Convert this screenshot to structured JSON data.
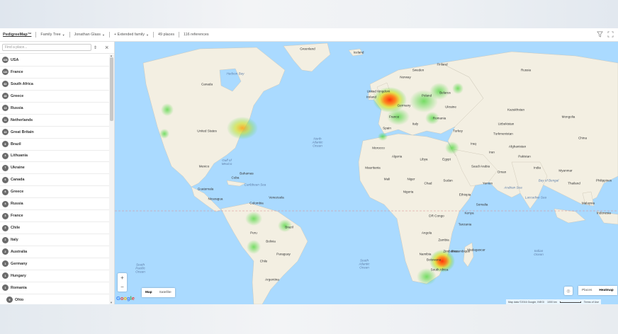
{
  "toolbar": {
    "brand": "PedigreeMap™",
    "family_tree": "Family Tree",
    "person": "Jonathan Glass",
    "extended": "+ Extended family",
    "places": "49 places",
    "references": "116 references"
  },
  "sidebar": {
    "search_placeholder": "Find a place...",
    "places": [
      {
        "count": "328",
        "name": "USA"
      },
      {
        "count": "110",
        "name": "France"
      },
      {
        "count": "62",
        "name": "South Africa"
      },
      {
        "count": "46",
        "name": "Greece"
      },
      {
        "count": "13",
        "name": "Russia"
      },
      {
        "count": "11",
        "name": "Netherlands"
      },
      {
        "count": "10",
        "name": "Great Britain"
      },
      {
        "count": "6",
        "name": "Brazil"
      },
      {
        "count": "4",
        "name": "Lithuania"
      },
      {
        "count": "7",
        "name": "Ukraine"
      },
      {
        "count": "6",
        "name": "Canada"
      },
      {
        "count": "6",
        "name": "Greece"
      },
      {
        "count": "4",
        "name": "Russia"
      },
      {
        "count": "3",
        "name": "France"
      },
      {
        "count": "2",
        "name": "Chile"
      },
      {
        "count": "2",
        "name": "Italy"
      },
      {
        "count": "2",
        "name": "Australia"
      },
      {
        "count": "1",
        "name": "Germany"
      },
      {
        "count": "1",
        "name": "Hungary"
      },
      {
        "count": "1",
        "name": "Romania"
      },
      {
        "count": "9",
        "name": "Ohio"
      }
    ]
  },
  "map": {
    "labels": {
      "greenland": "Greenland",
      "iceland": "Iceland",
      "hudson_bay": "Hudson Bay",
      "canada": "Canada",
      "united_states": "United States",
      "mexico": "Mexico",
      "gulf_mexico": "Gulf of\nMexico",
      "cuba": "Cuba",
      "caribbean": "Caribbean Sea",
      "venezuela": "Venezuela",
      "colombia": "Colombia",
      "peru": "Peru",
      "brazil": "Brazil",
      "bolivia": "Bolivia",
      "paraguay": "Paraguay",
      "chile": "Chile",
      "argentina": "Argentina",
      "north_atlantic": "North\nAtlantic\nOcean",
      "south_atlantic": "South\nAtlantic\nOcean",
      "south_pacific": "South\nPacific\nOcean",
      "indian_ocean": "Indian\nOcean",
      "sweden": "Sweden",
      "finland": "Finland",
      "norway": "Norway",
      "united_kingdom": "United\nKingdom",
      "ireland": "Ireland",
      "germany": "Germany",
      "poland": "Poland",
      "belarus": "Belarus",
      "ukraine": "Ukraine",
      "france": "France",
      "spain": "Spain",
      "italy": "Italy",
      "romania": "Romania",
      "turkey": "Turkey",
      "russia": "Russia",
      "kazakhstan": "Kazakhstan",
      "mongolia": "Mongolia",
      "china": "China",
      "turkmenistan": "Turkmenistan",
      "afghanistan": "Afghanistan",
      "iran": "Iran",
      "iraq": "Iraq",
      "pakistan": "Pakistan",
      "india": "India",
      "saudi_arabia": "Saudi Arabia",
      "egypt": "Egypt",
      "libya": "Libya",
      "algeria": "Algeria",
      "morocco": "Morocco",
      "mali": "Mali",
      "niger": "Niger",
      "chad": "Chad",
      "sudan": "Sudan",
      "ethiopia": "Ethiopia",
      "nigeria": "Nigeria",
      "kenya": "Kenya",
      "tanzania": "Tanzania",
      "dr_congo": "DR Congo",
      "angola": "Angola",
      "namibia": "Namibia",
      "south_africa": "South Africa",
      "madagascar": "Madagascar",
      "mauritania": "Mauritania",
      "myanmar": "Myanmar",
      "thailand": "Thailand",
      "philippines": "Philippines",
      "indonesia": "Indonesia",
      "malaysia": "Malaysia",
      "bay_bengal": "Bay of Bengal",
      "arabian_sea": "Arabian Sea",
      "laccadive": "Laccadive Sea",
      "zimbabwe": "Zimbabwe",
      "somalia": "Somalia",
      "yemen": "Yemen",
      "oman": "Oman",
      "kazakh": "Kazakhstan",
      "uzbekistan": "Uzbekistan",
      "bahamas": "Bahamas",
      "guatemala": "Guatemala",
      "nicaragua": "Nicaragua",
      "zambia": "Zambia",
      "botswana": "Botswana",
      "mozambique": "Mozambique"
    },
    "zoom_in": "+",
    "zoom_out": "−",
    "maptype_map": "Map",
    "maptype_satellite": "Satellite",
    "google": "Google",
    "mode_places": "Places",
    "mode_heatmap": "Heatmap",
    "attribution": "Map data ©2016 Google, INEGI",
    "scale": "1000 km",
    "terms": "Terms of Use"
  },
  "colors": {
    "water": "#aadaff",
    "land": "#f5f1e6",
    "park": "#cfe5b6"
  }
}
